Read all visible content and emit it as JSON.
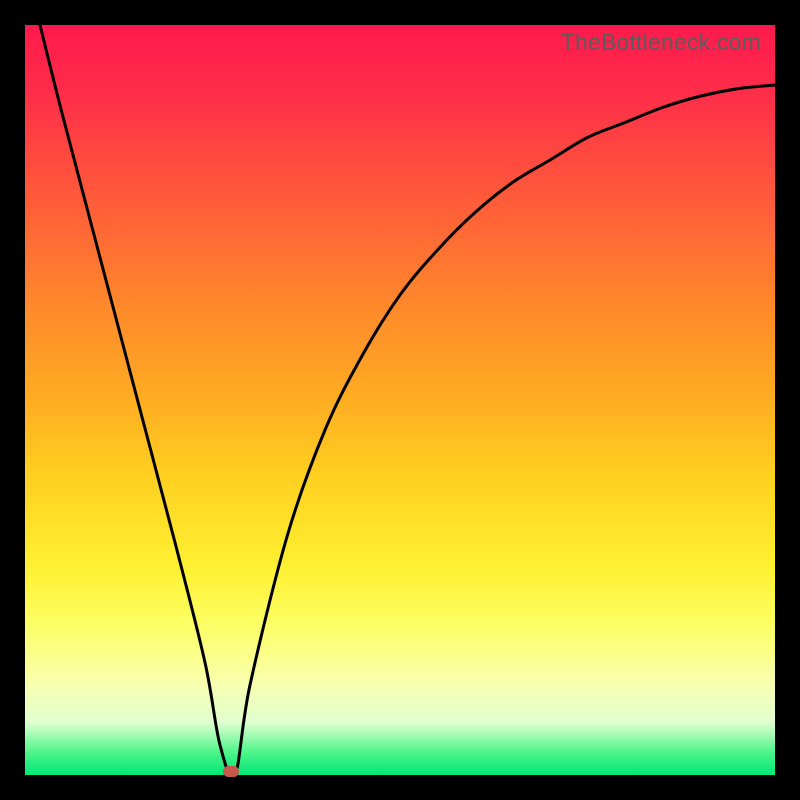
{
  "watermark": "TheBottleneck.com",
  "colors": {
    "frame_border": "#000000",
    "curve": "#000000",
    "marker": "#c55a4a"
  },
  "chart_data": {
    "type": "line",
    "title": "",
    "xlabel": "",
    "ylabel": "",
    "xlim": [
      0,
      100
    ],
    "ylim": [
      0,
      100
    ],
    "x": [
      2,
      5,
      10,
      15,
      20,
      24,
      26,
      28,
      30,
      35,
      40,
      45,
      50,
      55,
      60,
      65,
      70,
      75,
      80,
      85,
      90,
      95,
      100
    ],
    "values": [
      100,
      88,
      69,
      50,
      31,
      15,
      4,
      0,
      12,
      32,
      46,
      56,
      64,
      70,
      75,
      79,
      82,
      85,
      87,
      89,
      90.5,
      91.5,
      92
    ],
    "marker": {
      "x": 27.5,
      "y": 0
    }
  }
}
